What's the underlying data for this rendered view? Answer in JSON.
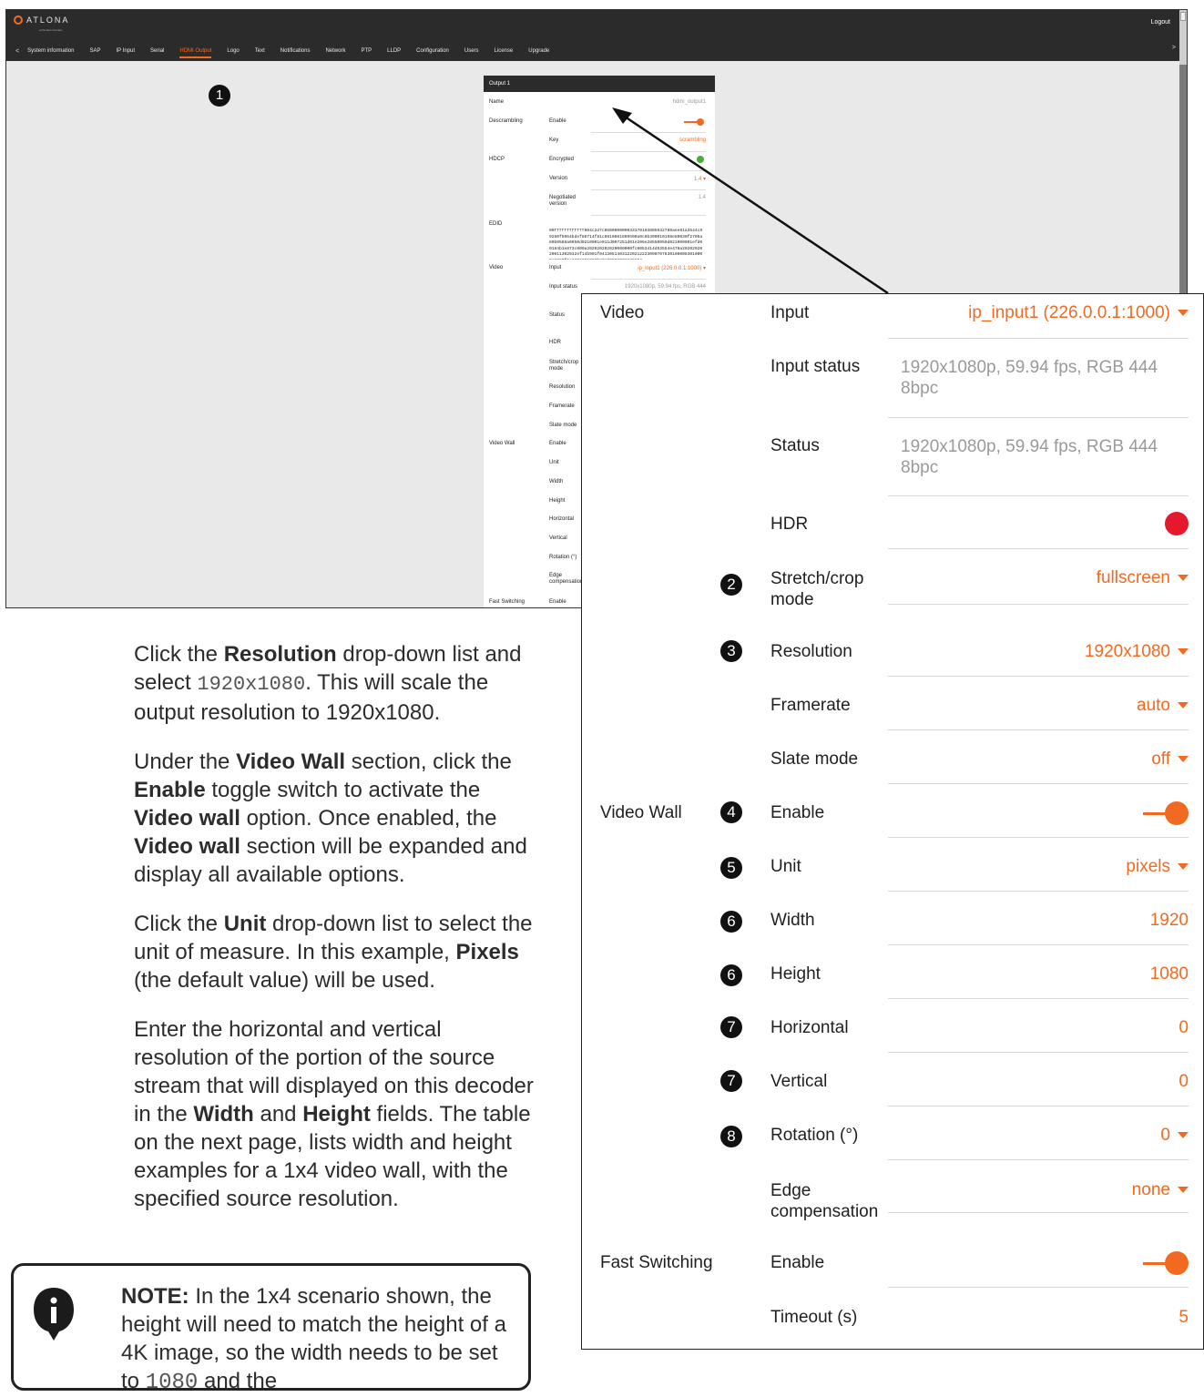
{
  "header": {
    "logo_text": "ATLONA",
    "logo_sub": "a Panduit company",
    "logout": "Logout",
    "nav_prev": "<",
    "nav_next": ">",
    "tabs": [
      "System information",
      "SAP",
      "IP Input",
      "Serial",
      "HDMI Output",
      "Logo",
      "Text",
      "Notifications",
      "Network",
      "PTP",
      "LLDP",
      "Configuration",
      "Users",
      "License",
      "Upgrade"
    ],
    "active_tab": "HDMI Output"
  },
  "callout_1": "1",
  "card": {
    "title": "Output 1",
    "rows": {
      "name_label": "Name",
      "name_value": "hdmi_output1",
      "descr_label": "Descrambling",
      "descr_enable": "Enable",
      "descr_key": "Key",
      "descr_key_value": "scrambling",
      "hdcp_label": "HDCP",
      "hdcp_enc": "Encrypted",
      "hdcp_version": "Version",
      "hdcp_version_value": "1.4",
      "hdcp_neg": "Negotiated version",
      "hdcp_neg_value": "1.4",
      "edid_label": "EDID",
      "edid_value": "00ffffffffffff004c2d7c0b0000000033170103805932780aee91a3544c99260f5054bdef80714f81c0810081809500a9c0b300010108e80030f2705a80b0588a0050d0210001e011d007251d01e206e28550050d021000001efd00184b1e873c000a202020202020000000fc0053414d53554e470a2020202020011302032ef14b901f041305140312202122230907078301000083010000e2000f6e030c001000b83c20008001020304",
      "video_label": "Video",
      "video_input": "Input",
      "video_input_value": "ip_input1 (226.0.0.1:1000)",
      "video_input_status": "Input status",
      "video_input_status_value": "1920x1080p, 59.94 fps, RGB 444",
      "video_status": "Status",
      "hdr": "HDR",
      "stretch": "Stretch/crop mode",
      "resolution": "Resolution",
      "framerate": "Framerate",
      "slate": "Slate mode",
      "vw_label": "Video Wall",
      "vw_enable": "Enable",
      "vw_unit": "Unit",
      "vw_width": "Width",
      "vw_height": "Height",
      "vw_horizontal": "Horizontal",
      "vw_vertical": "Vertical",
      "vw_rotation": "Rotation (°)",
      "vw_edge": "Edge compensation",
      "fs_label": "Fast Switching",
      "fs_enable": "Enable"
    }
  },
  "zoom": {
    "video_section": "Video",
    "input_label": "Input",
    "input_value": "ip_input1 (226.0.0.1:1000)",
    "input_status_label": "Input status",
    "input_status_value": "1920x1080p, 59.94 fps, RGB 444 8bpc",
    "status_label": "Status",
    "status_value": "1920x1080p, 59.94 fps, RGB 444 8bpc",
    "hdr_label": "HDR",
    "stretch_label": "Stretch/crop mode",
    "stretch_value": "fullscreen",
    "resolution_label": "Resolution",
    "resolution_value": "1920x1080",
    "framerate_label": "Framerate",
    "framerate_value": "auto",
    "slate_label": "Slate mode",
    "slate_value": "off",
    "videowall_section": "Video Wall",
    "vw_enable_label": "Enable",
    "unit_label": "Unit",
    "unit_value": "pixels",
    "width_label": "Width",
    "width_value": "1920",
    "height_label": "Height",
    "height_value": "1080",
    "horizontal_label": "Horizontal",
    "horizontal_value": "0",
    "vertical_label": "Vertical",
    "vertical_value": "0",
    "rotation_label": "Rotation (°)",
    "rotation_value": "0",
    "edge_label": "Edge compensation",
    "edge_value": "none",
    "fast_section": "Fast Switching",
    "fast_enable_label": "Enable",
    "timeout_label": "Timeout (s)",
    "timeout_value": "5",
    "badges": {
      "b2": "2",
      "b3": "3",
      "b4": "4",
      "b5": "5",
      "b6a": "6",
      "b6b": "6",
      "b7a": "7",
      "b7b": "7",
      "b8": "8"
    }
  },
  "colors": {
    "accent": "#f26a21",
    "hdr_dot": "#e5182d",
    "header_bg": "#2b2b2b"
  },
  "instructions": {
    "p1_a": "Click the ",
    "p1_b": "Resolution",
    "p1_c": " drop-down list and select ",
    "p1_mono": "1920x1080",
    "p1_d": ".  This will scale the output resolution to 1920x1080.",
    "p2_a": "Under the ",
    "p2_b": "Video Wall",
    "p2_c": " section, click the ",
    "p2_d": "Enable",
    "p2_e": " toggle switch to activate the ",
    "p2_f": "Video wall",
    "p2_g": " option. Once enabled, the ",
    "p2_h": "Video wall",
    "p2_i": " section will be expanded and display all available options.",
    "p3_a": "Click the ",
    "p3_b": "Unit",
    "p3_c": " drop-down list to select the unit of measure.  In this example, ",
    "p3_d": "Pixels",
    "p3_e": " (the default value) will be used.",
    "p4_a": "Enter the horizontal and vertical resolution of the portion of the source stream that will displayed on this decoder in the ",
    "p4_b": "Width",
    "p4_c": " and ",
    "p4_d": "Height",
    "p4_e": " fields.  The table on the next page, lists width and height examples for a 1x4 video wall, with the specified source resolution."
  },
  "note": {
    "label": "NOTE:",
    "text": "  In the 1x4 scenario shown, the height will need to match the height of a 4K image, so the width needs to be set to ",
    "mono": "1080",
    "text2": " and the"
  }
}
